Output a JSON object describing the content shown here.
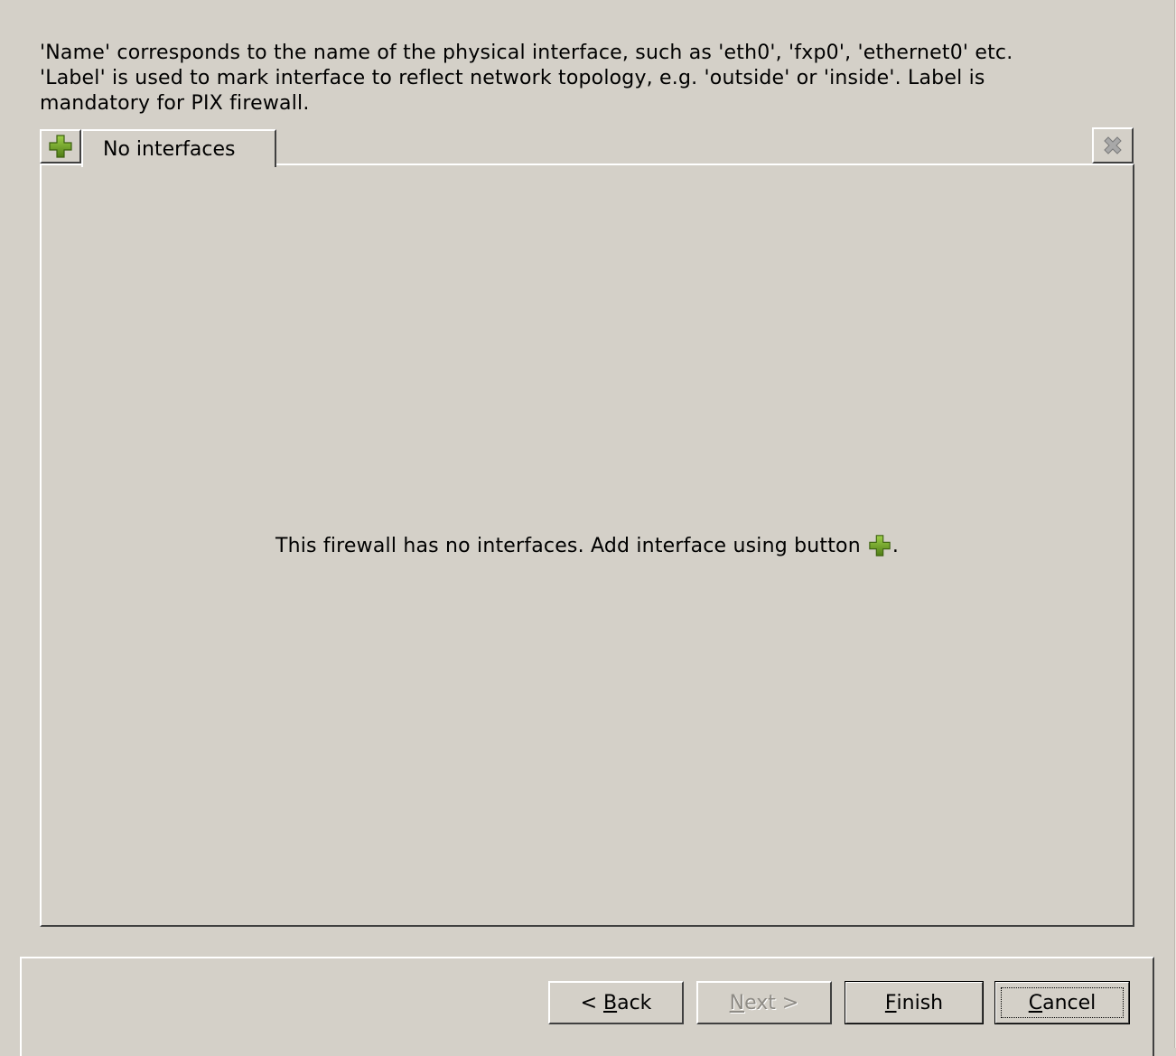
{
  "help": {
    "line1": "'Name' corresponds to the name of the physical interface, such as 'eth0', 'fxp0', 'ethernet0' etc.",
    "line2": "'Label' is used to mark interface to reflect network topology, e.g. 'outside' or 'inside'. Label is",
    "line3": "mandatory for PIX firewall."
  },
  "tabs": [
    {
      "label": "No interfaces"
    }
  ],
  "panel": {
    "empty_message": "This firewall has no interfaces. Add interface using button",
    "empty_suffix": "."
  },
  "icons": {
    "add": "plus-icon",
    "delete": "close-icon",
    "add_color": "#5a8a1e",
    "delete_color": "#9a9a9a"
  },
  "buttons": {
    "back": {
      "prefix": "< ",
      "mnemonic": "B",
      "rest": "ack"
    },
    "next": {
      "mnemonic": "N",
      "rest": "ext >"
    },
    "finish": {
      "mnemonic": "F",
      "rest": "inish"
    },
    "cancel": {
      "mnemonic": "C",
      "rest": "ancel"
    }
  }
}
